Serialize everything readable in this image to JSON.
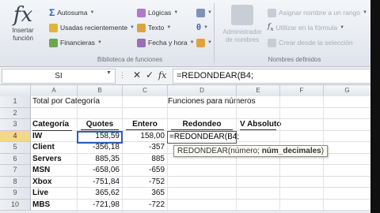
{
  "ribbon": {
    "insert_function": {
      "line1": "Insertar",
      "line2": "función"
    },
    "library_items": [
      {
        "label": "Autosuma",
        "icon": "sigma-icon"
      },
      {
        "label": "Usadas recientemente",
        "icon": "star-icon"
      },
      {
        "label": "Financieras",
        "icon": "book-icon"
      },
      {
        "label": "Lógicas",
        "icon": "book-icon"
      },
      {
        "label": "Texto",
        "icon": "text-icon"
      },
      {
        "label": "Fecha y hora",
        "icon": "clock-icon"
      }
    ],
    "library_label": "Biblioteca de funciones",
    "name_manager": {
      "line1": "Administrador",
      "line2": "de nombres"
    },
    "defined_items": [
      {
        "label": "Asignar nombre a un rango"
      },
      {
        "label": "Utilizar en la fórmula"
      },
      {
        "label": "Crear desde la selección"
      }
    ],
    "defined_label": "Nombres definidos"
  },
  "formula_bar": {
    "name_box": "SI",
    "cancel": "✕",
    "enter": "✓",
    "fx": "fx",
    "formula": "=REDONDEAR(B4;"
  },
  "columns": [
    "A",
    "B",
    "C",
    "D",
    "E",
    "F",
    "G"
  ],
  "rows": [
    {
      "n": "1",
      "a": "Total por Categoría",
      "b": "",
      "c": "",
      "d": "Funciones para números",
      "e": ""
    },
    {
      "n": "2",
      "a": "",
      "b": "",
      "c": "",
      "d": "",
      "e": ""
    },
    {
      "n": "3",
      "a": "Categoría",
      "b": "Quotes",
      "c": "Entero",
      "d": "Redondeo",
      "e": "V Absoluto"
    },
    {
      "n": "4",
      "a": "IW",
      "b": "158,59",
      "c": "158,00",
      "d": "=REDONDEAR(B4;",
      "e": ""
    },
    {
      "n": "5",
      "a": "Client",
      "b": "-356,18",
      "c": "-357",
      "d": "",
      "e": ""
    },
    {
      "n": "6",
      "a": "Servers",
      "b": "885,35",
      "c": "885",
      "d": "",
      "e": ""
    },
    {
      "n": "7",
      "a": "MSN",
      "b": "-658,06",
      "c": "-659",
      "d": "",
      "e": ""
    },
    {
      "n": "8",
      "a": "Xbox",
      "b": "-751,84",
      "c": "-752",
      "d": "",
      "e": ""
    },
    {
      "n": "9",
      "a": "Live",
      "b": "365,62",
      "c": "365",
      "d": "",
      "e": ""
    },
    {
      "n": "10",
      "a": "MBS",
      "b": "-721,98",
      "c": "-722",
      "d": "",
      "e": ""
    }
  ],
  "tooltip": {
    "fn": "REDONDEAR(",
    "arg1": "número",
    "sep": "; ",
    "arg2": "núm_decimales",
    "close": ")"
  }
}
